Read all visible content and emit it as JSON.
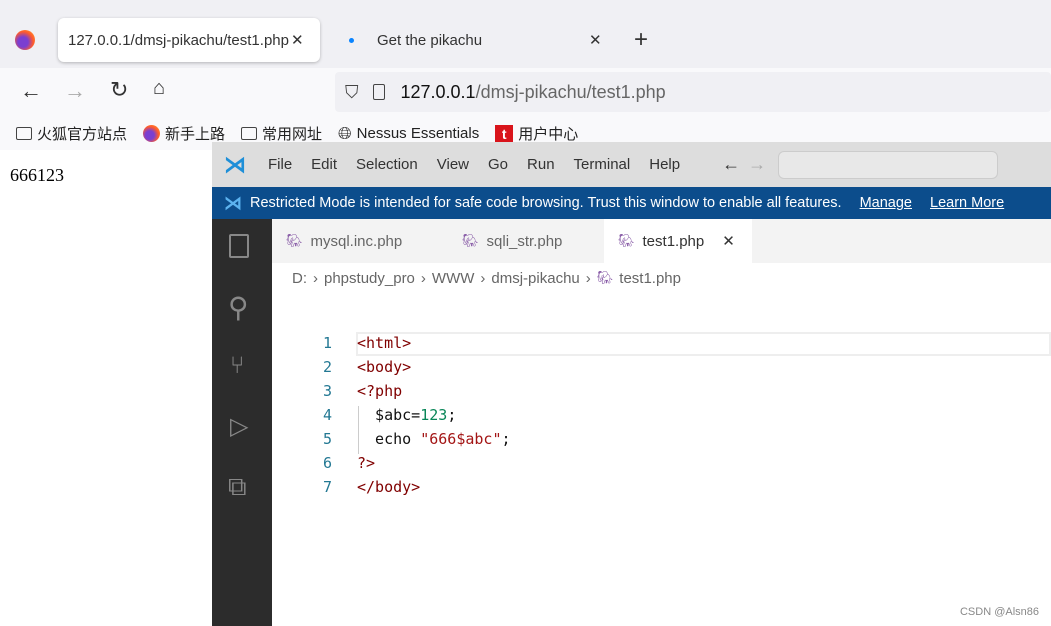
{
  "browser": {
    "tabs": [
      {
        "label": "127.0.0.1/dmsj-pikachu/test1.php",
        "active": true
      },
      {
        "label": "Get the pikachu",
        "active": false
      }
    ],
    "url_host": "127.0.0.1",
    "url_path": "/dmsj-pikachu/test1.php",
    "bookmarks": [
      {
        "label": "火狐官方站点",
        "icon": "folder-icon"
      },
      {
        "label": "新手上路",
        "icon": "firefox-icon"
      },
      {
        "label": "常用网址",
        "icon": "folder-icon"
      },
      {
        "label": "Nessus Essentials",
        "icon": "globe-icon"
      },
      {
        "label": "用户中心",
        "icon": "red-t-icon"
      }
    ],
    "page_output": "666123"
  },
  "vscode": {
    "menu": [
      "File",
      "Edit",
      "Selection",
      "View",
      "Go",
      "Run",
      "Terminal",
      "Help"
    ],
    "banner": {
      "text": "Restricted Mode is intended for safe code browsing. Trust this window to enable all features.",
      "manage": "Manage",
      "learn_more": "Learn More"
    },
    "tabs": [
      {
        "label": "mysql.inc.php"
      },
      {
        "label": "sqli_str.php"
      },
      {
        "label": "test1.php",
        "active": true
      }
    ],
    "breadcrumb": [
      "D:",
      "phpstudy_pro",
      "WWW",
      "dmsj-pikachu",
      "test1.php"
    ],
    "code": [
      {
        "n": "1",
        "text": "<html>"
      },
      {
        "n": "2",
        "text": "<body>"
      },
      {
        "n": "3",
        "text": "<?php"
      },
      {
        "n": "4",
        "a": "  $abc=",
        "b": "123",
        "c": ";"
      },
      {
        "n": "5",
        "a": "  echo ",
        "b": "\"666$abc\"",
        "c": ";"
      },
      {
        "n": "6",
        "text": "?>"
      },
      {
        "n": "7",
        "text": "</body>"
      }
    ]
  },
  "watermark": "CSDN @Alsn86"
}
